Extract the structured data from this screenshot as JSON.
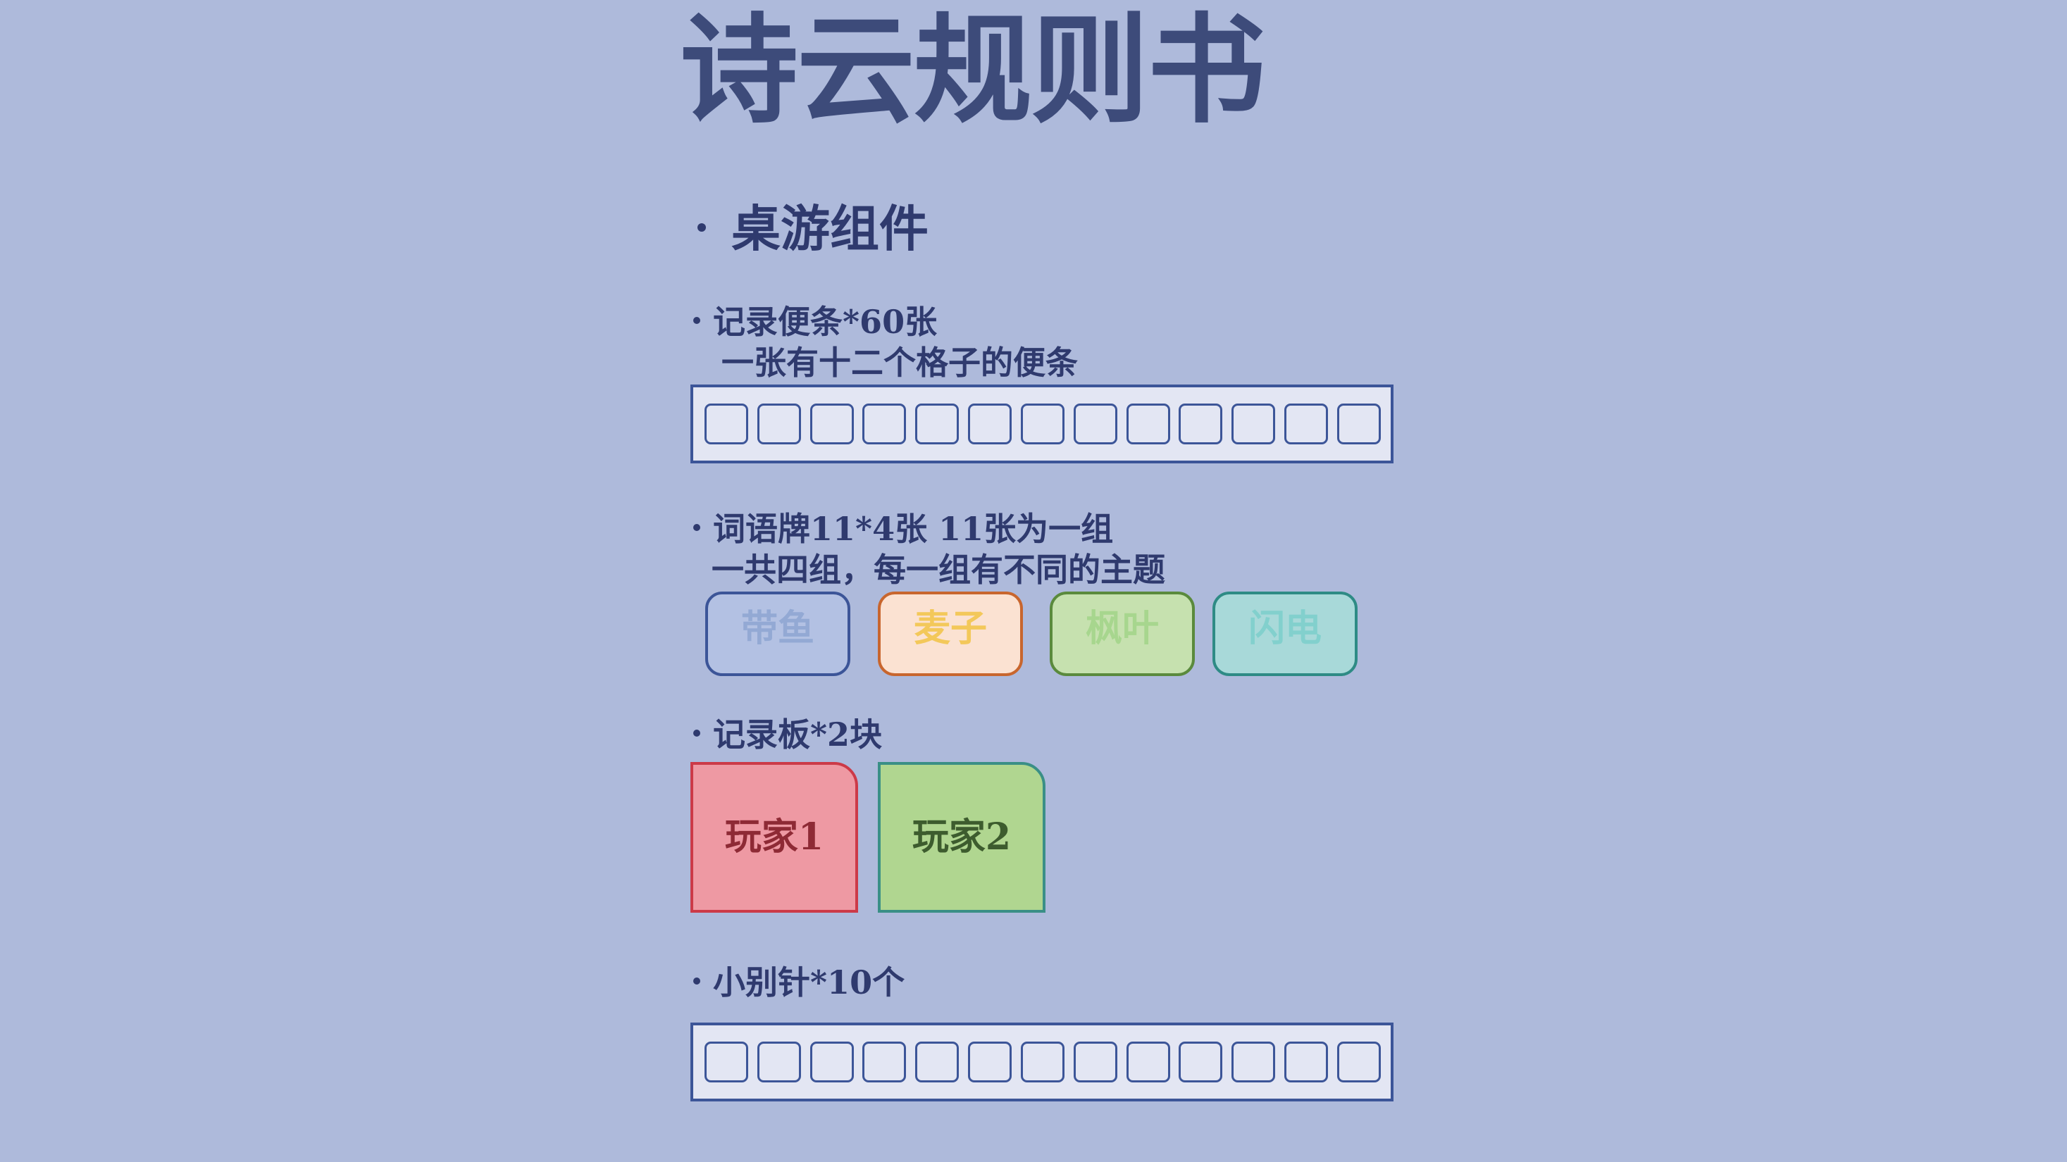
{
  "title": "诗云规则书",
  "section_heading": "桌游组件",
  "memo": {
    "line1": "记录便条*60张",
    "line2": "一张有十二个格子的便条",
    "cell_count": 13
  },
  "word_cards": {
    "line1": "词语牌11*4张  11张为一组",
    "line2": "一共四组，每一组有不同的主题",
    "cards": [
      {
        "label": "带鱼",
        "bg": "#b3c1e3",
        "border": "#3c5598",
        "text": "#93a9d4"
      },
      {
        "label": "麦子",
        "bg": "#fbe2d2",
        "border": "#c8662e",
        "text": "#f3c85a"
      },
      {
        "label": "枫叶",
        "bg": "#c6e1af",
        "border": "#5a8a3d",
        "text": "#a7d68e"
      },
      {
        "label": "闪电",
        "bg": "#a8d9d9",
        "border": "#2e8b85",
        "text": "#82d0cd"
      }
    ]
  },
  "boards": {
    "line1": "记录板*2块",
    "items": [
      {
        "label": "玩家1",
        "bg": "#ee99a3",
        "border": "#cc3a48",
        "text": "#8e2a35"
      },
      {
        "label": "玩家2",
        "bg": "#b0d690",
        "border": "#3a8f86",
        "text": "#3d5c2e"
      }
    ]
  },
  "pins": {
    "line1": "小别针*10个",
    "cell_count": 13
  }
}
